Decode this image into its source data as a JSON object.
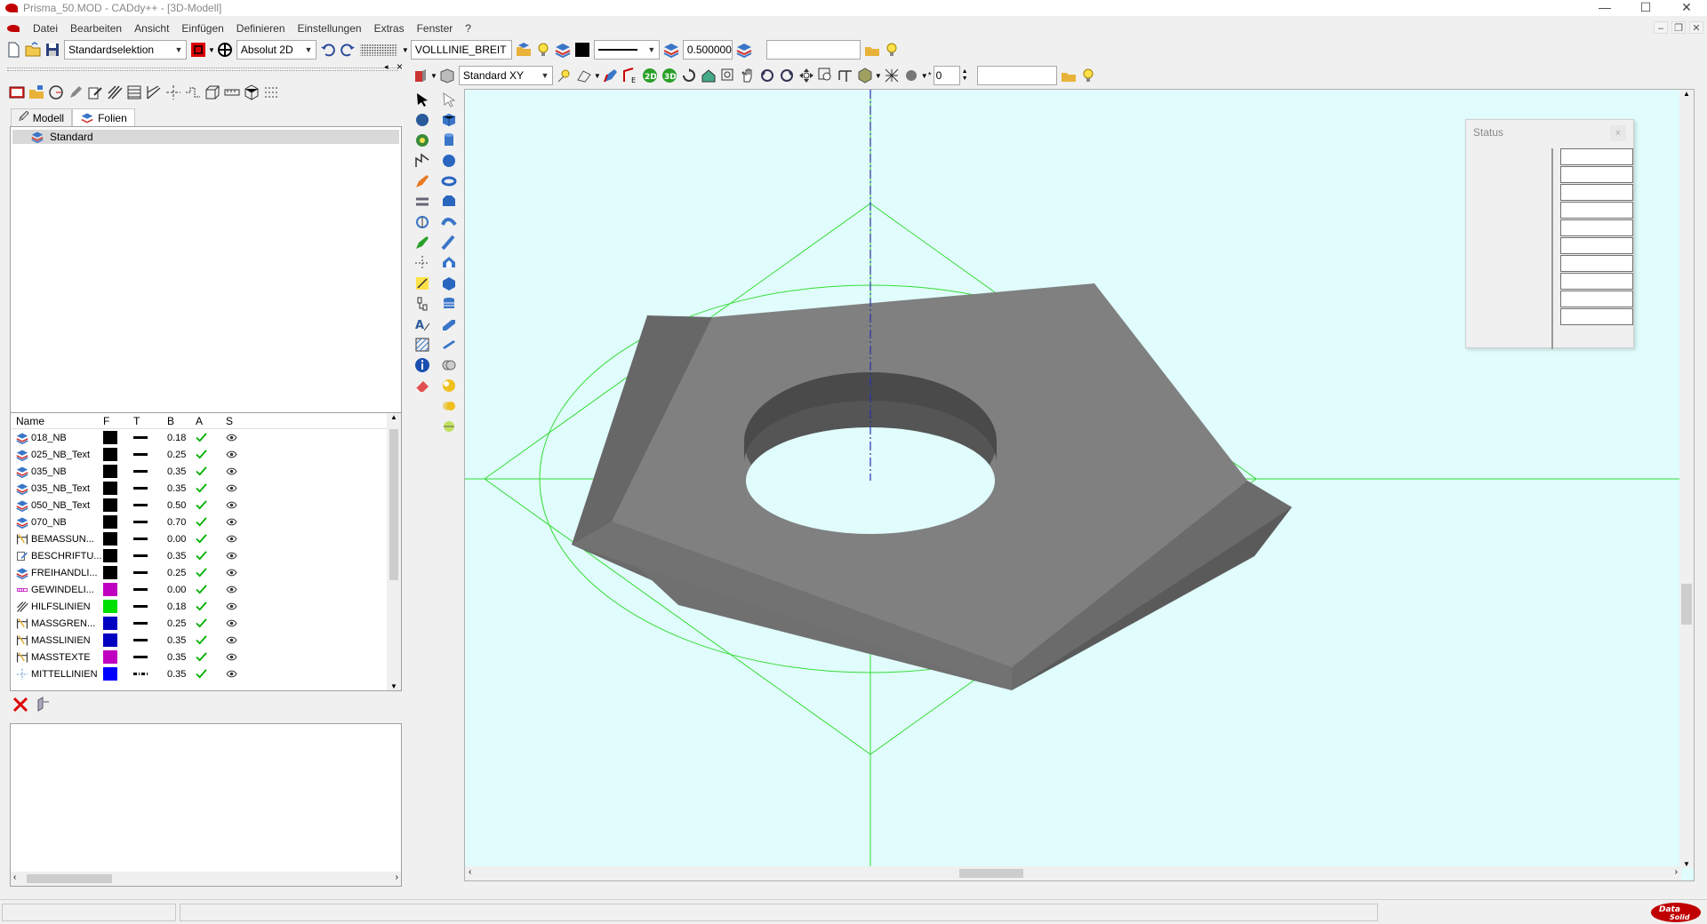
{
  "window": {
    "title": "Prisma_50.MOD - CADdy++ - [3D-Modell]",
    "controls": [
      "—",
      "☐",
      "✕"
    ]
  },
  "menu": [
    "Datei",
    "Bearbeiten",
    "Ansicht",
    "Einfügen",
    "Definieren",
    "Einstellungen",
    "Extras",
    "Fenster",
    "?"
  ],
  "toolbar_top": {
    "selection_mode": "Standardselektion",
    "coord_mode": "Absolut 2D",
    "line_style_name": "VOLLLINIE_BREIT",
    "line_width": "0.500000",
    "search_value": ""
  },
  "toolbar_view": {
    "view_plane": "Standard XY",
    "spinner_value": "0",
    "mode_2d": "2D",
    "mode_3d": "3D",
    "input_value": ""
  },
  "panel_tabs": {
    "modell": "Modell",
    "folien": "Folien"
  },
  "layer_tree": {
    "root": "Standard"
  },
  "layer_table": {
    "headers": {
      "name": "Name",
      "f": "F",
      "t": "T",
      "b": "B",
      "a": "A",
      "s": "S"
    },
    "rows": [
      {
        "name": "018_NB",
        "color": "#000000",
        "width": "0.18",
        "line": "solid",
        "icon": "layer"
      },
      {
        "name": "025_NB_Text",
        "color": "#000000",
        "width": "0.25",
        "line": "solid",
        "icon": "layer"
      },
      {
        "name": "035_NB",
        "color": "#000000",
        "width": "0.35",
        "line": "solid",
        "icon": "layer"
      },
      {
        "name": "035_NB_Text",
        "color": "#000000",
        "width": "0.35",
        "line": "solid",
        "icon": "layer"
      },
      {
        "name": "050_NB_Text",
        "color": "#000000",
        "width": "0.50",
        "line": "solid",
        "icon": "layer"
      },
      {
        "name": "070_NB",
        "color": "#000000",
        "width": "0.70",
        "line": "solid",
        "icon": "layer"
      },
      {
        "name": "BEMASSUN...",
        "color": "#000000",
        "width": "0.00",
        "line": "solid",
        "icon": "dim"
      },
      {
        "name": "BESCHRIFTU...",
        "color": "#000000",
        "width": "0.35",
        "line": "solid",
        "icon": "text"
      },
      {
        "name": "FREIHANDLI...",
        "color": "#000000",
        "width": "0.25",
        "line": "solid",
        "icon": "layer"
      },
      {
        "name": "GEWINDELI...",
        "color": "#c000c0",
        "width": "0.00",
        "line": "solid",
        "icon": "thread"
      },
      {
        "name": "HILFSLINIEN",
        "color": "#00e000",
        "width": "0.18",
        "line": "solid",
        "icon": "aux"
      },
      {
        "name": "MASSGREN...",
        "color": "#0000c0",
        "width": "0.25",
        "line": "solid",
        "icon": "dim"
      },
      {
        "name": "MASSLINIEN",
        "color": "#0000c0",
        "width": "0.35",
        "line": "solid",
        "icon": "dim"
      },
      {
        "name": "MASSTEXTE",
        "color": "#c000c0",
        "width": "0.35",
        "line": "solid",
        "icon": "dim"
      },
      {
        "name": "MITTELLINIEN",
        "color": "#0000ff",
        "width": "0.35",
        "line": "dash",
        "icon": "center"
      }
    ]
  },
  "status_panel": {
    "title": "Status",
    "close": "×",
    "cells": 10
  },
  "colors": {
    "viewport_bg": "#e0fcfc",
    "construction_lines": "#33dd33",
    "axis_line": "#2233aa",
    "solid_top": "#808080",
    "check": "#00b000",
    "brand_red": "#c00000"
  },
  "brand": {
    "line1": "Data",
    "line2": "Solid"
  }
}
